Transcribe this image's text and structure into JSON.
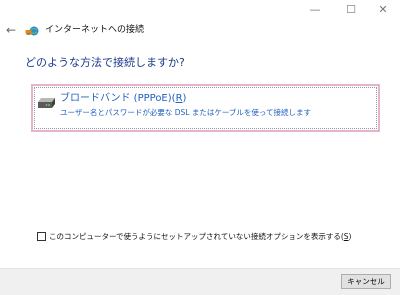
{
  "window": {
    "minimize_glyph": "—",
    "maximize_glyph": "☐",
    "close_glyph": "✕"
  },
  "nav": {
    "back_glyph": "←",
    "title": "インターネットへの接続",
    "icon": "network-globe-icon"
  },
  "main": {
    "heading": "どのような方法で接続しますか?",
    "option": {
      "title": "ブロードバンド (PPPoE)(",
      "accesskey": "R",
      "title_end": ")",
      "description": "ユーザー名とパスワードが必要な DSL またはケーブルを使って接続します",
      "icon": "broadband-modem-icon"
    },
    "checkbox": {
      "checked": false,
      "label_prefix": "このコンピューターで使うようにセットアップされていない接続オプションを表示する(",
      "accesskey": "S",
      "label_suffix": ")"
    }
  },
  "footer": {
    "cancel_label": "キャンセル"
  },
  "colors": {
    "heading": "#1c3a8a",
    "link": "#1f5fc0",
    "option_border": "#e6b3cd"
  }
}
